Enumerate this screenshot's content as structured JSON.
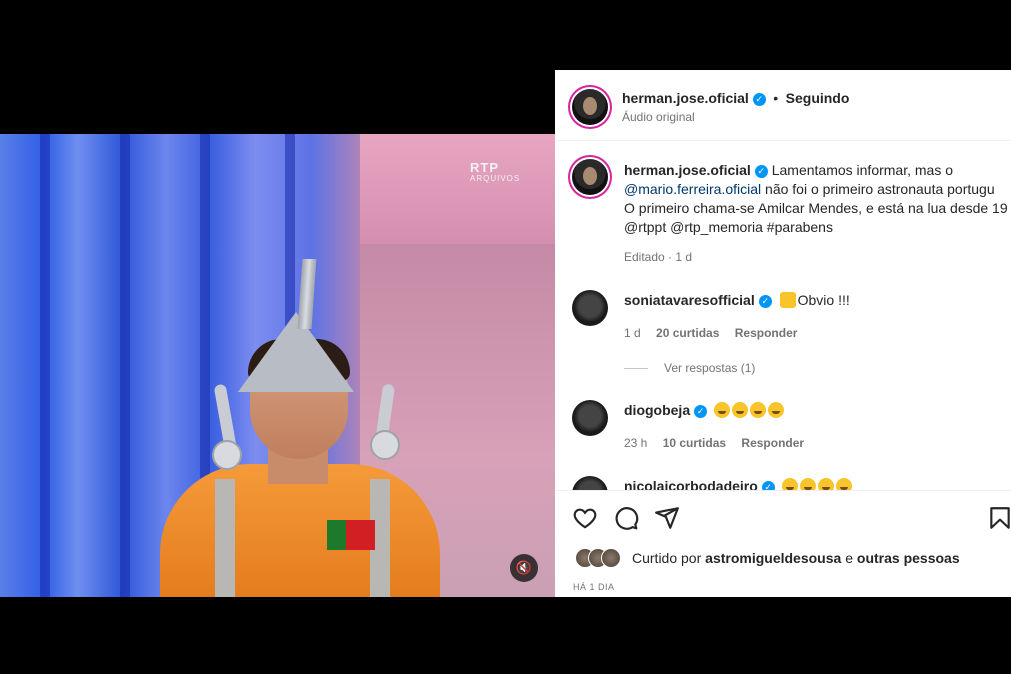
{
  "video": {
    "watermark_main": "RTP",
    "watermark_sub": "ARQUIVOS",
    "mute_icon": "🔇"
  },
  "post": {
    "header": {
      "username": "herman.jose.oficial",
      "separator": "•",
      "follow_status": "Seguindo",
      "audio": "Áudio original"
    },
    "caption": {
      "username": "herman.jose.oficial",
      "text_1": "Lamentamos informar, mas o",
      "mention_1": "@mario.ferreira.oficial",
      "text_2": "não foi o primeiro astronauta portugu",
      "text_3": "O primeiro chama-se Amilcar Mendes, e está na lua desde 19",
      "tags": "@rtppt @rtp_memoria #parabens",
      "meta": "Editado · 1 d"
    },
    "comments": [
      {
        "username": "soniatavaresofficial",
        "text": "Obvio !!!",
        "time": "1 d",
        "likes": "20 curtidas",
        "reply": "Responder",
        "view_replies": "Ver respostas (1)"
      },
      {
        "username": "diogobeja",
        "time": "23 h",
        "likes": "10 curtidas",
        "reply": "Responder"
      },
      {
        "username": "nicolaicorbodadeiro"
      }
    ],
    "actions": {
      "liked_prefix": "Curtido por",
      "liked_user": "astromigueldesousa",
      "liked_and": "e",
      "liked_others": "outras pessoas",
      "date": "HÁ 1 DIA"
    }
  },
  "colors": {
    "accent_blue": "#0095f6",
    "link_blue": "#00376b",
    "text": "#262626",
    "muted": "#737373"
  }
}
